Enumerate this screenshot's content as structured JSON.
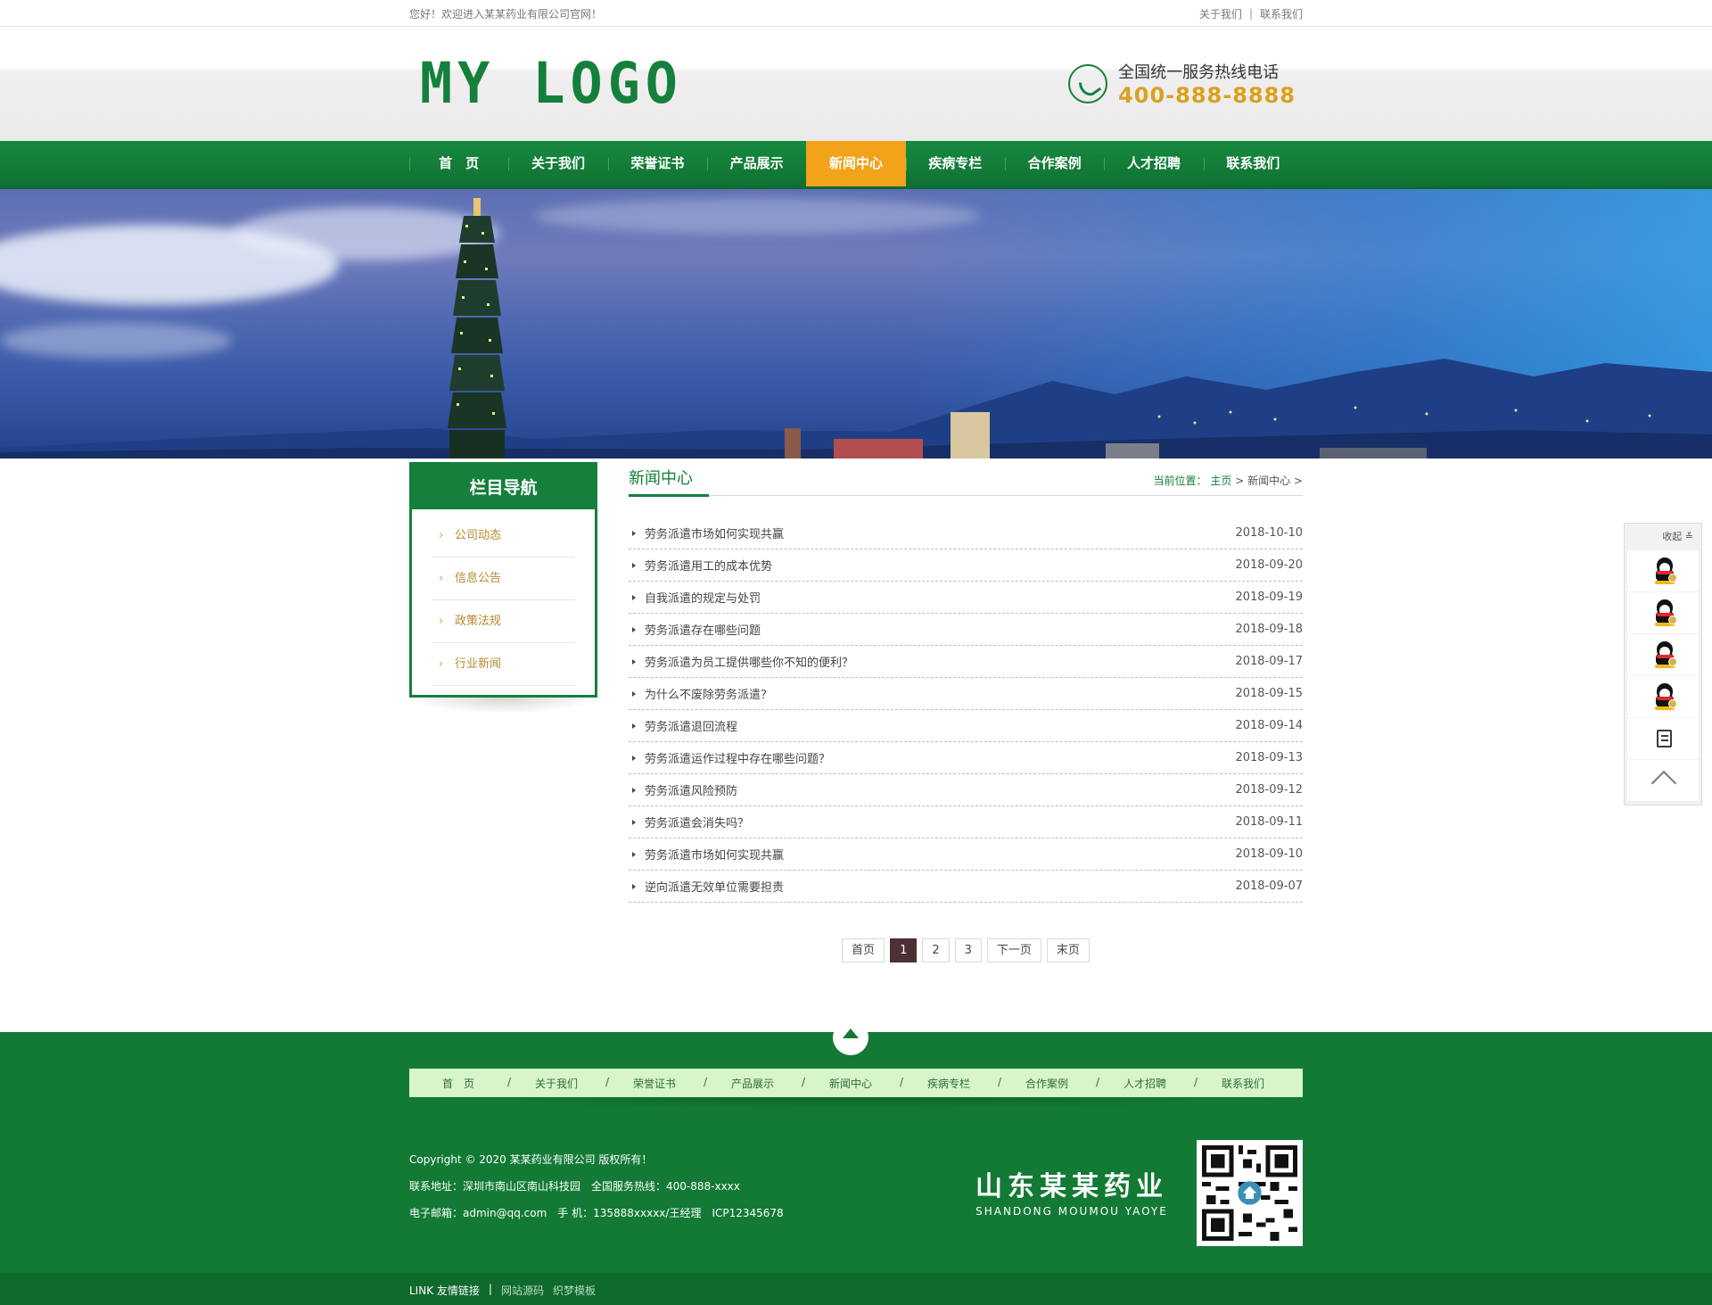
{
  "topbar": {
    "welcome": "您好！欢迎进入某某药业有限公司官网！",
    "links": [
      "关于我们",
      "联系我们"
    ],
    "separator": "|"
  },
  "header": {
    "logo": "MY LOGO",
    "hotline_label": "全国统一服务热线电话",
    "hotline_number": "400-888-8888"
  },
  "nav": {
    "items": [
      "首　页",
      "关于我们",
      "荣誉证书",
      "产品展示",
      "新闻中心",
      "疾病专栏",
      "合作案例",
      "人才招聘",
      "联系我们"
    ],
    "active_index": 4
  },
  "sidebar": {
    "title": "栏目导航",
    "items": [
      "公司动态",
      "信息公告",
      "政策法规",
      "行业新闻"
    ]
  },
  "content": {
    "title": "新闻中心",
    "breadcrumb_label": "当前位置：",
    "breadcrumb_home": "主页",
    "breadcrumb_sep": ">",
    "breadcrumb_current": "新闻中心",
    "news": [
      {
        "title": "劳务派遣市场如何实现共赢",
        "date": "2018-10-10"
      },
      {
        "title": "劳务派遣用工的成本优势",
        "date": "2018-09-20"
      },
      {
        "title": "自我派遣的规定与处罚",
        "date": "2018-09-19"
      },
      {
        "title": "劳务派遣存在哪些问题",
        "date": "2018-09-18"
      },
      {
        "title": "劳务派遣为员工提供哪些你不知的便利？",
        "date": "2018-09-17"
      },
      {
        "title": "为什么不废除劳务派遣？",
        "date": "2018-09-15"
      },
      {
        "title": "劳务派遣退回流程",
        "date": "2018-09-14"
      },
      {
        "title": "劳务派遣运作过程中存在哪些问题？",
        "date": "2018-09-13"
      },
      {
        "title": "劳务派遣风险预防",
        "date": "2018-09-12"
      },
      {
        "title": "劳务派遣会消失吗？",
        "date": "2018-09-11"
      },
      {
        "title": "劳务派遣市场如何实现共赢",
        "date": "2018-09-10"
      },
      {
        "title": "逆向派遣无效单位需要担责",
        "date": "2018-09-07"
      }
    ]
  },
  "pager": {
    "first": "首页",
    "pages": [
      "1",
      "2",
      "3"
    ],
    "current": "1",
    "next": "下一页",
    "last": "末页"
  },
  "footer": {
    "nav": [
      "首　页",
      "关于我们",
      "荣誉证书",
      "产品展示",
      "新闻中心",
      "疾病专栏",
      "合作案例",
      "人才招聘",
      "联系我们"
    ],
    "nav_separator": "/",
    "copyright": "Copyright © 2020 某某药业有限公司 版权所有！",
    "address": "联系地址：深圳市南山区南山科技园　全国服务热线：400-888-xxxx",
    "contact": "电子邮箱：admin@qq.com　手 机：135888xxxxx/王经理　ICP12345678",
    "brand_cn": "山东某某药业",
    "brand_en": "SHANDONG MOUMOU YAOYE"
  },
  "bottombar": {
    "label": "LINK 友情链接",
    "separator": "|",
    "links": [
      "网站源码",
      "织梦模板"
    ]
  },
  "float_widget": {
    "collapse_label": "收起 ≚"
  },
  "colors": {
    "brand_green": "#14803b",
    "active_orange": "#f2a31a",
    "hotline_gold": "#d8a21f",
    "sidebar_item_gold": "#b48a2c"
  }
}
